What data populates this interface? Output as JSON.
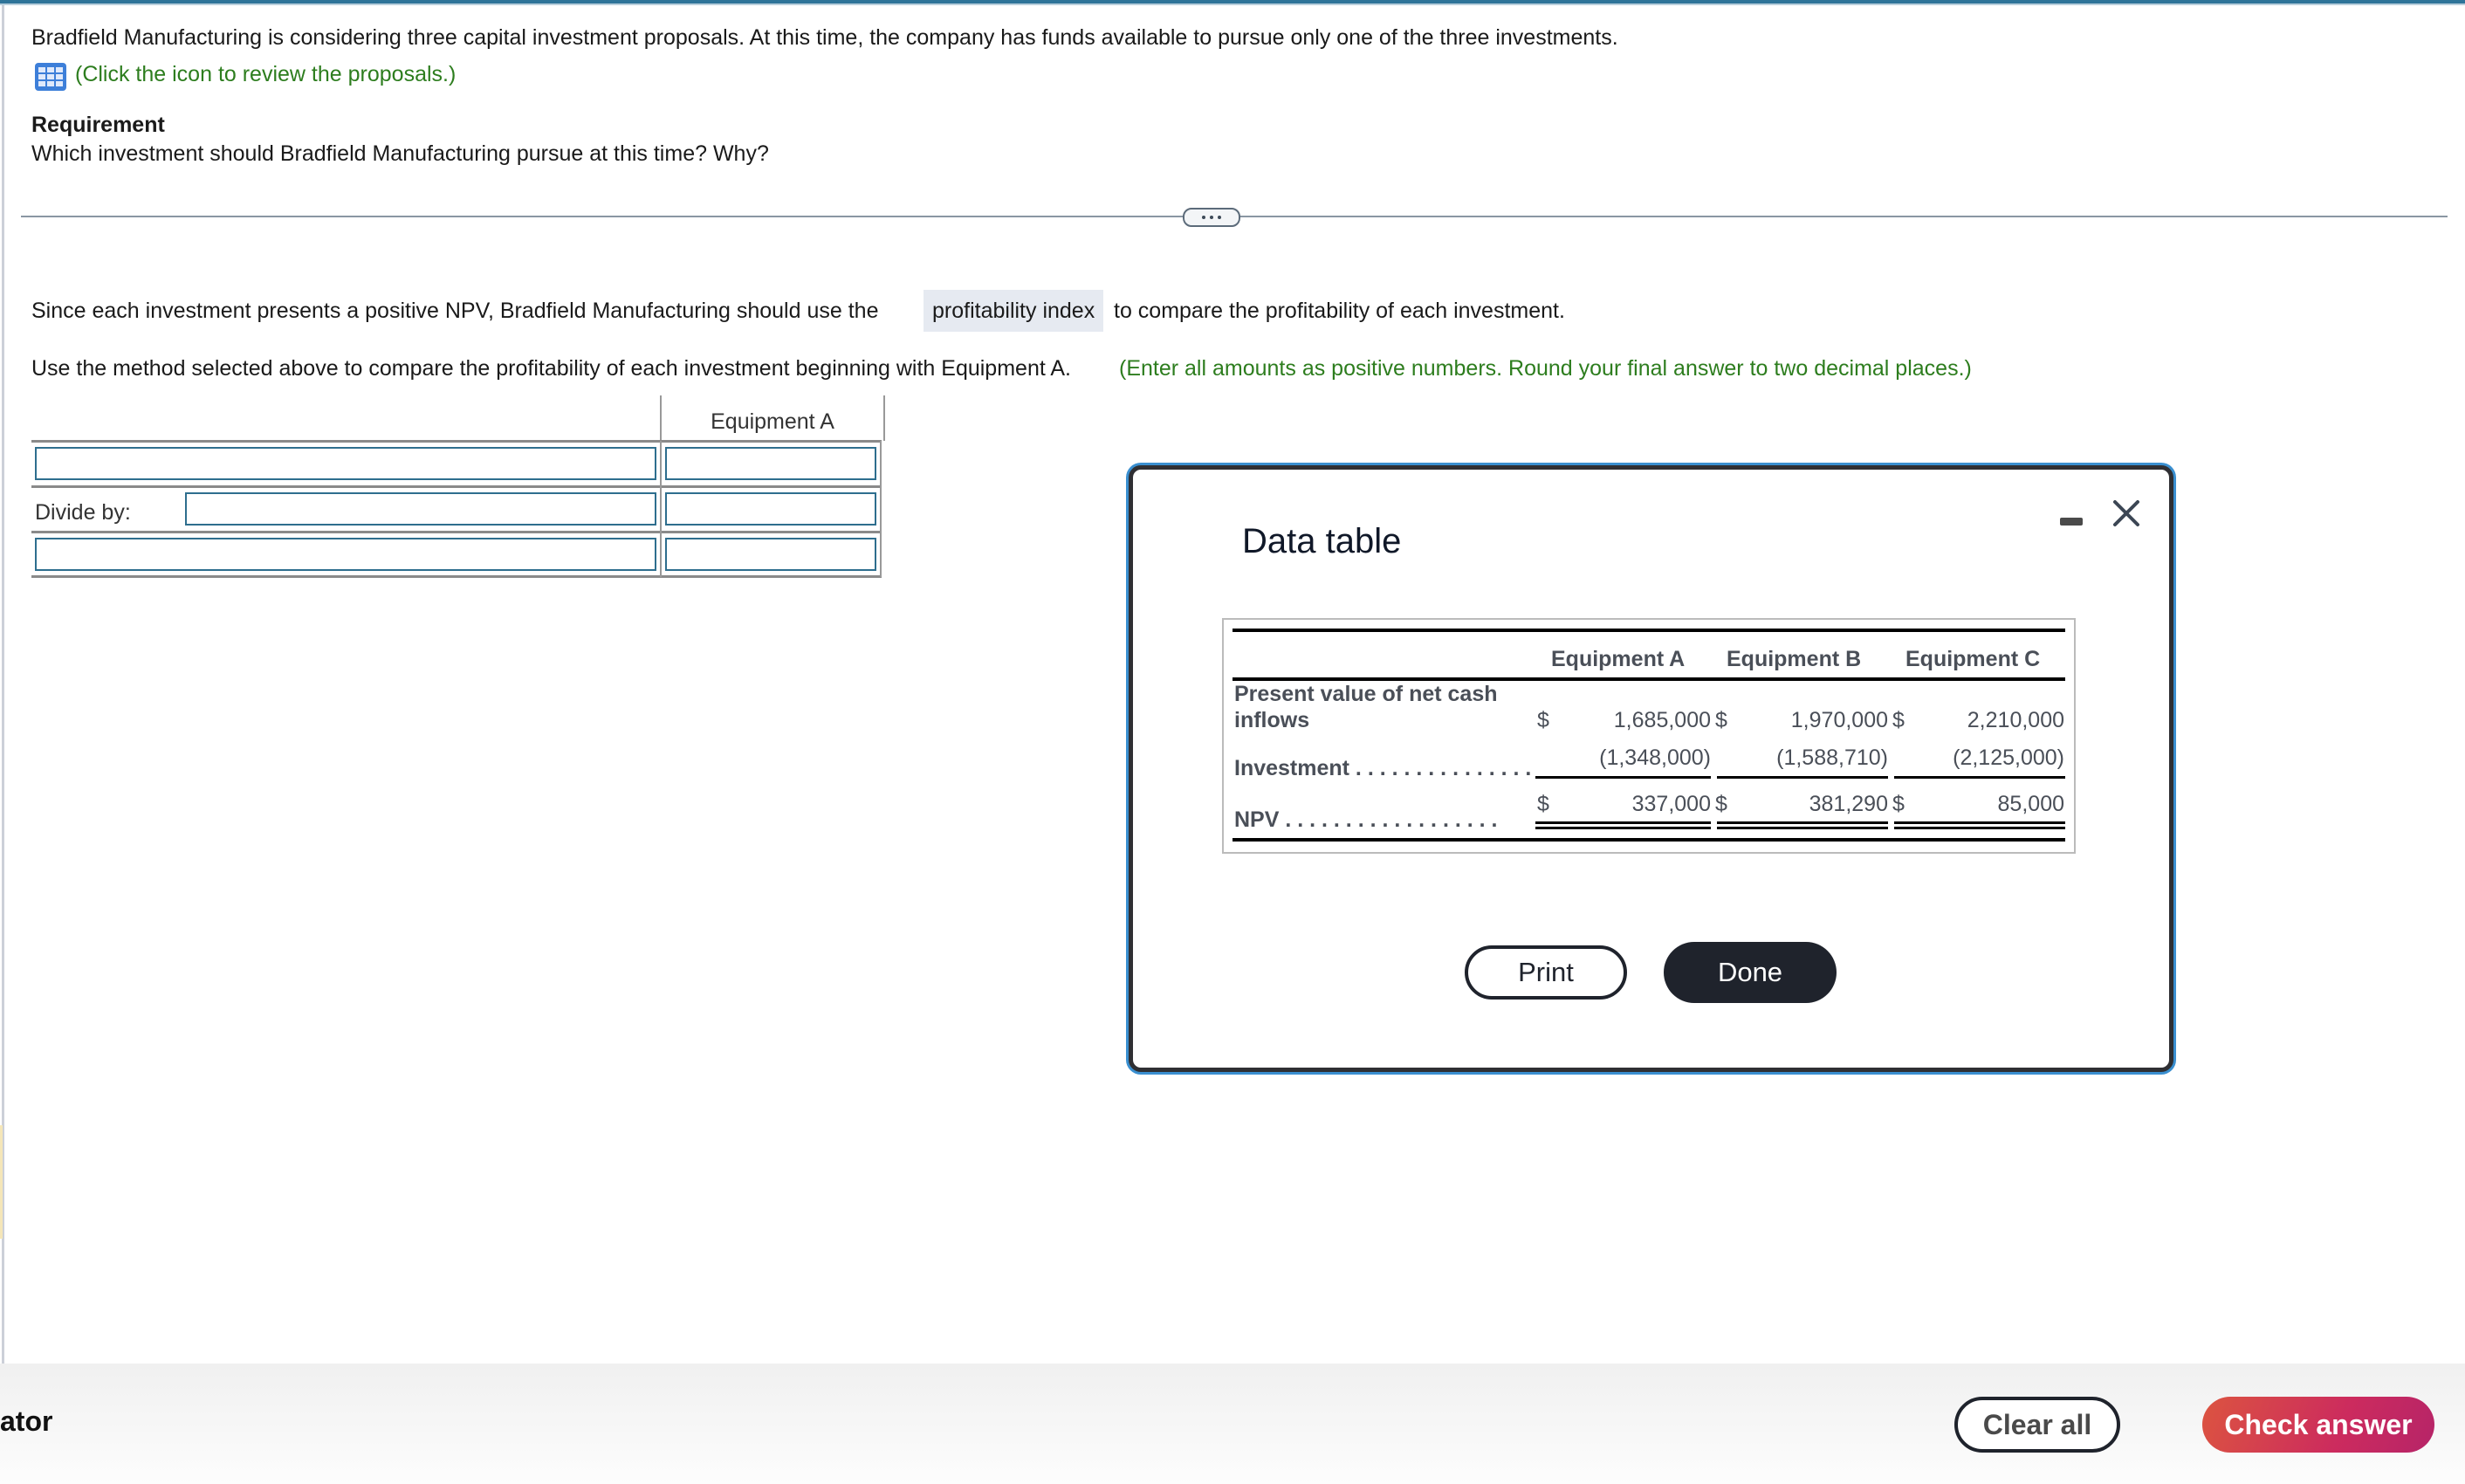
{
  "question": {
    "intro": "Bradfield Manufacturing is considering three capital investment proposals. At this time, the company has funds available to pursue only one of the three investments.",
    "icon_hint": "(Click the icon to review the proposals.)",
    "icon": "table-grid-icon",
    "requirement_heading": "Requirement",
    "requirement_text": "Which investment should Bradfield Manufacturing pursue at this time? Why?"
  },
  "divider": {
    "more_button": "more-options"
  },
  "answer": {
    "sentence_before": "Since each investment presents a positive NPV, Bradfield Manufacturing should use the",
    "selected_method": "profitability index",
    "sentence_after": "to compare the profitability of each investment.",
    "instruction": "Use the method selected above to compare the profitability of each investment beginning with Equipment A.",
    "instruction_note": "(Enter all amounts as positive numbers. Round your final answer to two decimal places.)",
    "table": {
      "column_header": "Equipment A",
      "divide_label": "Divide by:",
      "rows": [
        {
          "label_value": "",
          "value": ""
        },
        {
          "label_value": "",
          "value": ""
        },
        {
          "label_value": "",
          "value": ""
        }
      ]
    }
  },
  "modal": {
    "title": "Data table",
    "minimize": "minimize",
    "close": "close",
    "table": {
      "columns": [
        "Equipment A",
        "Equipment B",
        "Equipment C"
      ],
      "rows": [
        {
          "label": "Present value of net cash inflows",
          "label_line1": "Present value of net cash",
          "label_line2": "inflows",
          "currency": "$",
          "values": [
            "1,685,000",
            "1,970,000",
            "2,210,000"
          ]
        },
        {
          "label": "Investment",
          "currency": "",
          "values": [
            "(1,348,000)",
            "(1,588,710)",
            "(2,125,000)"
          ]
        },
        {
          "label": "NPV",
          "currency": "$",
          "values": [
            "337,000",
            "381,290",
            "85,000"
          ]
        }
      ]
    },
    "print_label": "Print",
    "done_label": "Done"
  },
  "footer": {
    "left_label": "ator",
    "clear_label": "Clear all",
    "check_label": "Check answer"
  },
  "colors": {
    "accent_teal": "#2e7499",
    "hint_green": "#2d7d1e",
    "check_gradient_start": "#dc5440",
    "check_gradient_end": "#b62468",
    "modal_border_blue": "#3a8fd0"
  }
}
